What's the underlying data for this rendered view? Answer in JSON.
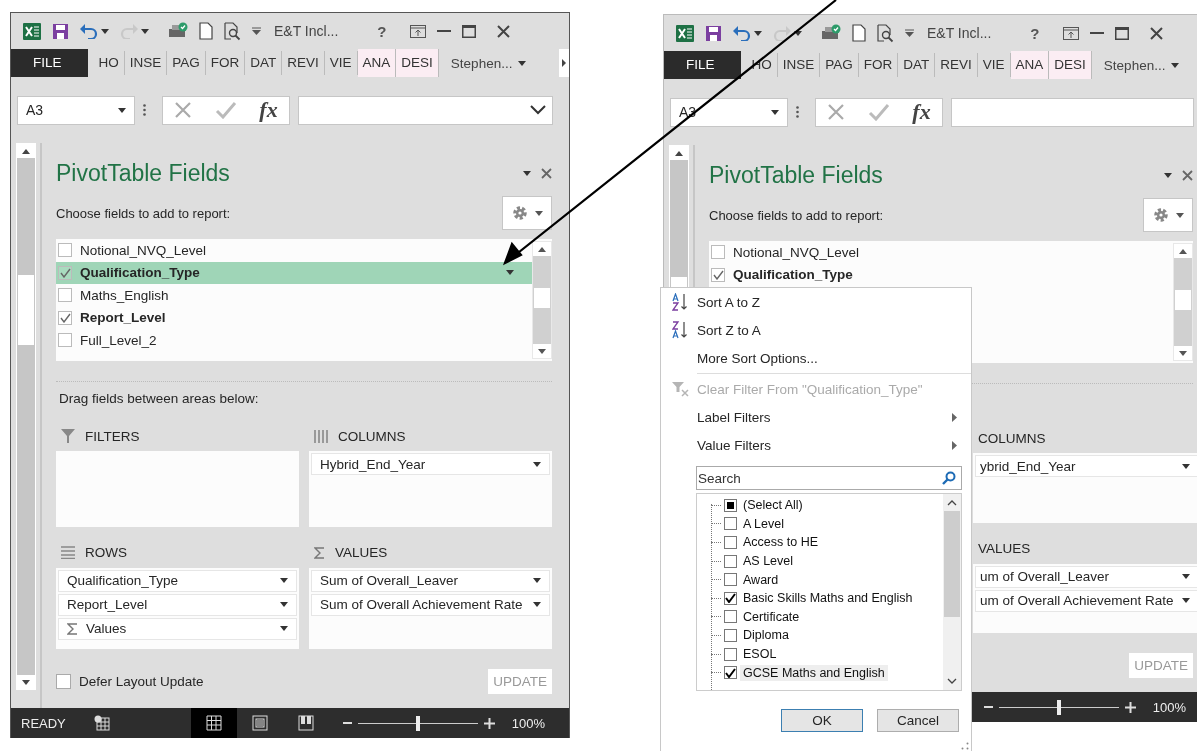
{
  "windows": [
    {
      "title": "E&T Incl...",
      "help_label": "?",
      "cut_at_edge": false,
      "covered_by_menu": false,
      "ribbon_tabs": [
        {
          "label": "FILE",
          "kind": "file"
        },
        {
          "label": "HO",
          "kind": "normal"
        },
        {
          "label": "INSE",
          "kind": "normal"
        },
        {
          "label": "PAG",
          "kind": "normal"
        },
        {
          "label": "FOR",
          "kind": "normal"
        },
        {
          "label": "DAT",
          "kind": "normal"
        },
        {
          "label": "REVI",
          "kind": "normal"
        },
        {
          "label": "VIE",
          "kind": "normal"
        },
        {
          "label": "ANA",
          "kind": "contextual"
        },
        {
          "label": "DESI",
          "kind": "contextual"
        }
      ],
      "account": "Stephen...",
      "name_box": "A3",
      "function_label": "fx",
      "pane": {
        "title": "PivotTable Fields",
        "choose_label": "Choose fields to add to report:",
        "fields": [
          {
            "label": "Notional_NVQ_Level",
            "checked": false,
            "selected": false
          },
          {
            "label": "Qualification_Type",
            "checked": true,
            "selected": true
          },
          {
            "label": "Maths_English",
            "checked": false,
            "selected": false
          },
          {
            "label": "Report_Level",
            "checked": true,
            "selected": false
          },
          {
            "label": "Full_Level_2",
            "checked": false,
            "selected": false
          }
        ],
        "drag_label": "Drag fields between areas below:",
        "areas": [
          {
            "kind": "filters",
            "heading": "FILTERS"
          },
          {
            "kind": "columns",
            "heading": "COLUMNS",
            "items": [
              {
                "label": "Hybrid_End_Year",
                "kind": "field"
              }
            ]
          },
          {
            "kind": "rows",
            "heading": "ROWS",
            "items": [
              {
                "label": "Qualification_Type",
                "kind": "field"
              },
              {
                "label": "Report_Level",
                "kind": "field"
              },
              {
                "label": "Values",
                "kind": "values"
              }
            ]
          },
          {
            "kind": "values",
            "heading": "VALUES",
            "items": [
              {
                "label": "Sum of Overall_Leaver",
                "kind": "field"
              },
              {
                "label": "Sum of Overall Achievement Rate",
                "kind": "field"
              }
            ]
          }
        ],
        "defer": {
          "label": "Defer Layout Update",
          "checked": false
        },
        "update_button": {
          "label": "UPDATE",
          "disabled": true
        }
      },
      "status_bar": {
        "status": "READY",
        "views": [
          {
            "kind": "normal",
            "selected": true
          },
          {
            "kind": "page_layout",
            "selected": false
          },
          {
            "kind": "page_break",
            "selected": false
          }
        ],
        "zoom_slider": {
          "level": 0.5
        },
        "zoom": "100%"
      }
    },
    {
      "title": "E&T Incl...",
      "help_label": "?",
      "cut_at_edge": true,
      "covered_by_menu": true,
      "ribbon_tabs": [
        {
          "label": "FILE",
          "kind": "file"
        },
        {
          "label": "HO",
          "kind": "normal"
        },
        {
          "label": "INSE",
          "kind": "normal"
        },
        {
          "label": "PAG",
          "kind": "normal"
        },
        {
          "label": "FOR",
          "kind": "normal"
        },
        {
          "label": "DAT",
          "kind": "normal"
        },
        {
          "label": "REVI",
          "kind": "normal"
        },
        {
          "label": "VIE",
          "kind": "normal"
        },
        {
          "label": "ANA",
          "kind": "contextual"
        },
        {
          "label": "DESI",
          "kind": "contextual"
        }
      ],
      "account": "Stephen...",
      "name_box": "A3",
      "function_label": "fx",
      "pane": {
        "title": "PivotTable Fields",
        "choose_label": "Choose fields to add to report:",
        "fields": [
          {
            "label": "Notional_NVQ_Level",
            "checked": false,
            "selected": false
          },
          {
            "label": "Qualification_Type",
            "checked": true,
            "selected": false
          }
        ],
        "areas": [
          {
            "heading": "COLUMNS",
            "items": [
              {
                "label": "ybrid_End_Year",
                "kind": "field"
              }
            ]
          },
          {
            "heading": "VALUES",
            "items": [
              {
                "label": "um of Overall_Leaver",
                "kind": "field"
              },
              {
                "label": "um of Overall Achievement Rate",
                "kind": "field"
              }
            ]
          }
        ],
        "update_button": {
          "label": "UPDATE",
          "disabled": true
        }
      },
      "status_bar": {
        "zoom_slider": {
          "level": 0.5
        },
        "zoom": "100%"
      }
    }
  ],
  "filter_menu": {
    "items": [
      {
        "label": "Sort A to Z",
        "kind": "sort_asc",
        "disabled": false
      },
      {
        "label": "Sort Z to A",
        "kind": "sort_desc",
        "disabled": false
      },
      {
        "label": "More Sort Options...",
        "kind": "plain",
        "disabled": false
      },
      {
        "label": "Clear Filter From \"Qualification_Type\"",
        "kind": "clear_filter",
        "disabled": true
      },
      {
        "label": "Label Filters",
        "kind": "submenu",
        "disabled": false
      },
      {
        "label": "Value Filters",
        "kind": "submenu",
        "disabled": false
      }
    ],
    "search": {
      "placeholder": "Search"
    },
    "values": [
      {
        "label": "(Select All)",
        "checked": false,
        "indeterminate": true,
        "selected": false
      },
      {
        "label": "A Level",
        "checked": false,
        "indeterminate": false,
        "selected": false
      },
      {
        "label": "Access to HE",
        "checked": false,
        "indeterminate": false,
        "selected": false
      },
      {
        "label": "AS Level",
        "checked": false,
        "indeterminate": false,
        "selected": false
      },
      {
        "label": "Award",
        "checked": false,
        "indeterminate": false,
        "selected": false
      },
      {
        "label": "Basic Skills Maths and English",
        "checked": true,
        "indeterminate": false,
        "selected": false
      },
      {
        "label": "Certificate",
        "checked": false,
        "indeterminate": false,
        "selected": false
      },
      {
        "label": "Diploma",
        "checked": false,
        "indeterminate": false,
        "selected": false
      },
      {
        "label": "ESOL",
        "checked": false,
        "indeterminate": false,
        "selected": false
      },
      {
        "label": "GCSE Maths and English",
        "checked": true,
        "indeterminate": false,
        "selected": true
      }
    ],
    "buttons": [
      {
        "label": "OK",
        "default": true
      },
      {
        "label": "Cancel",
        "default": false
      }
    ]
  }
}
